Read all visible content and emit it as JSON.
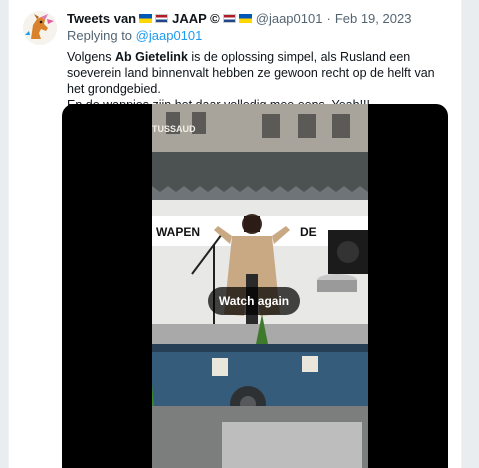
{
  "tweet": {
    "author_name": "Tweets van",
    "author_name_suffix": "JAAP ©",
    "handle": "@jaap0101",
    "separator": "·",
    "date": "Feb 19, 2023",
    "replying_prefix": "Replying to",
    "replying_handle": "@jaap0101",
    "text_part1": "Volgens ",
    "text_bold": "Ab Gietelink",
    "text_part2": " is de oplossing simpel, als Rusland een soeverein land binnenvalt hebben ze gewoon recht op de helft van het grondgebied.",
    "text_line2": "En de wappies zijn het daar volledig mee eens, Yeah!!!"
  },
  "video": {
    "watch_again_label": "Watch again",
    "building_sign": "TUSSAUD",
    "banner_text_left": "WAPEN",
    "banner_text_right": "DE"
  },
  "colors": {
    "link": "#1d9bf0",
    "muted": "#536471",
    "text": "#0f1419",
    "flag_ua_blue": "#0057b7",
    "flag_ua_yellow": "#ffd700",
    "flag_nl_red": "#ae1c28",
    "flag_nl_blue": "#21468b"
  },
  "icons": [
    "avatar-horse-logo",
    "ukraine-flag-icon",
    "netherlands-flag-icon"
  ]
}
